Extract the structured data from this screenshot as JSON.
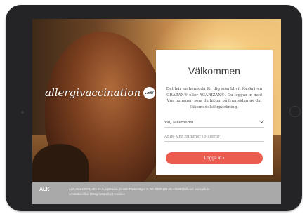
{
  "hero": {
    "logo_text": "allergivaccination",
    "logo_badge": ".se"
  },
  "login": {
    "title": "Välkommen",
    "description": "Det här en hemsida för dig som blivit förskriven GRAZAX® eller ACARIZAX®. Du loggar in med Vnr nummer, som du hittar på framsidan av din läkemedelsförpackning.",
    "select_label": "Välj läkemedel",
    "vnr_placeholder": "Ange Vnr nummer (6 siffror)",
    "login_button": "Logga in ›"
  },
  "footer": {
    "brand": "ALK",
    "address_line": "ALK, Box 10073, 401 21 Kungsbacka. Besök: Faktorvägen 9. Tel: 0300-185 43, infoSE@alk.net. www.alk.se",
    "links_line": "Användarvillkor | Integritetspolicy | Cookies"
  },
  "colors": {
    "accent_button": "#ec5c4e",
    "footer_bg": "#a9a9a9",
    "device_bezel": "#242426"
  }
}
